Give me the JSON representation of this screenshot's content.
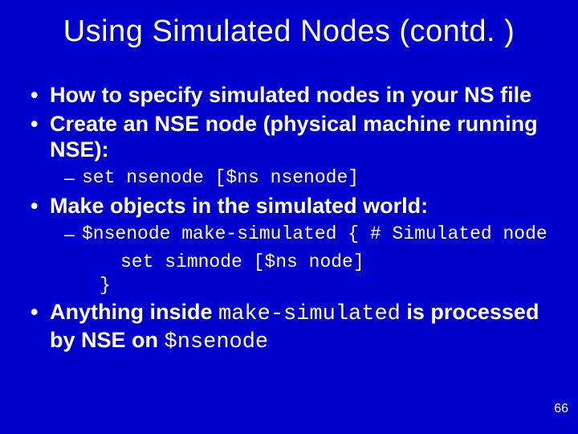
{
  "title": "Using Simulated Nodes (contd. )",
  "bullets": {
    "b1": "How to specify simulated nodes in your NS file",
    "b2": "Create an NSE node (physical machine running NSE):",
    "b2_code": "set nsenode [$ns nsenode]",
    "b3": "Make objects in the simulated world:",
    "b3_code_l1": "$nsenode make-simulated { # Simulated node",
    "b3_code_l2": "set simnode [$ns node]",
    "b3_code_l3": "}",
    "b4_pre": "Anything inside ",
    "b4_code1": "make-simulated",
    "b4_mid": " is processed by NSE on ",
    "b4_code2": "$nsenode"
  },
  "slide_number": "66"
}
